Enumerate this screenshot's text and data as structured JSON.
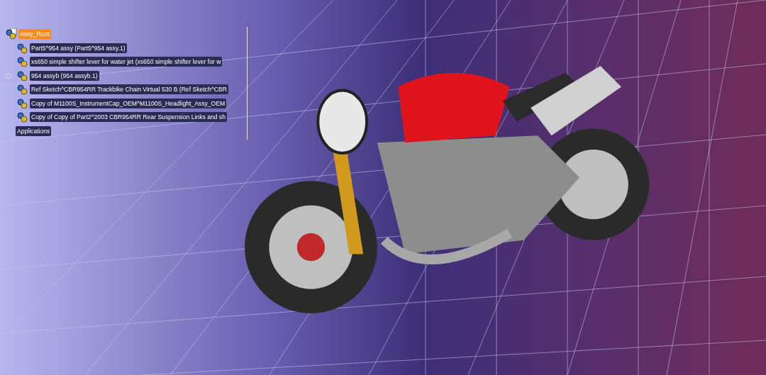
{
  "tree": {
    "root": {
      "label": "Assy_Root",
      "selected": true,
      "children": [
        {
          "label": "Part5^954 assy (Part5^954 assy.1)",
          "selected": false
        },
        {
          "label": "xs650 simple shifter lever for water jet (xs650 simple shifter lever for w",
          "selected": false
        },
        {
          "label": "954 assyb (954 assyb.1)",
          "selected": false,
          "expanded": false
        },
        {
          "label": "Ref Sketch^CBR954RR Trackbike Chain Virtual 530 B (Ref Sketch^CBR",
          "selected": false
        },
        {
          "label": "Copy of M1100S_InstrumentCap_OEM^M1100S_Headlight_Assy_OEM",
          "selected": false
        },
        {
          "label": "Copy of Copy of Part2^2003 CBR954RR Rear Suspension Links and sh",
          "selected": false
        }
      ]
    },
    "footer": {
      "label": "Applications",
      "selected": false
    }
  }
}
